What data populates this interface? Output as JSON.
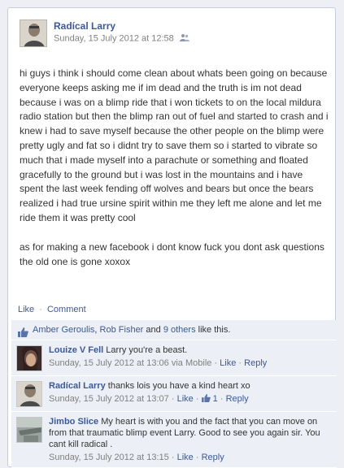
{
  "post": {
    "author": "Radícal Larry",
    "timestamp": "Sunday, 15 July 2012 at 12:58",
    "privacy_icon": "friends-icon",
    "paragraphs": [
      "hi guys i think i should come clean about whats been going on because everyone keeps asking me if im dead and the truth is im not dead because i was on a blimp ride that i won tickets to on the local mildura radio station but then the blimp ran out of fuel and started to crash and i knew i had to save myself because the other people on the blimp were pretty ugly and fat so i didnt try to save them so i started to vibrate so much that i made myself into a parachute or something and floated gracefully to the ground but i was lost in the mountains and i have spent the last week fending off wolves and bears but once the bears realized i had true ursine spirit within me they left me alone and let me ride them it was pretty cool",
      "as for making a new facebook i dont know fuck you dont ask questions the old one is gone xoxox"
    ]
  },
  "actions": {
    "like": "Like",
    "separator": "·",
    "comment": "Comment"
  },
  "likes": {
    "name1": "Amber Geroulis",
    "comma": ",",
    "name2": "Rob Fisher",
    "and": "and",
    "others": "9 others",
    "suffix": "like this."
  },
  "comments": [
    {
      "name": "Louize V Fell",
      "text": "Larry you're a beast.",
      "time": "Sunday, 15 July 2012 at 13:06 via Mobile",
      "like": "Like",
      "reply": "Reply",
      "sep": "·"
    },
    {
      "name": "Radícal Larry",
      "text": "thanks lois you have a kind heart xo",
      "time": "Sunday, 15 July 2012 at 13:07",
      "like": "Like",
      "like_count": "1",
      "reply": "Reply",
      "sep": "·"
    },
    {
      "name": "Jimbo Slice",
      "text": "My heart is with you and the fact that you can move on from that traumatic blimp event Larry. Good to see you again sir. You cant kill radical .",
      "time": "Sunday, 15 July 2012 at 13:15",
      "like": "Like",
      "reply": "Reply",
      "sep": "·"
    }
  ]
}
